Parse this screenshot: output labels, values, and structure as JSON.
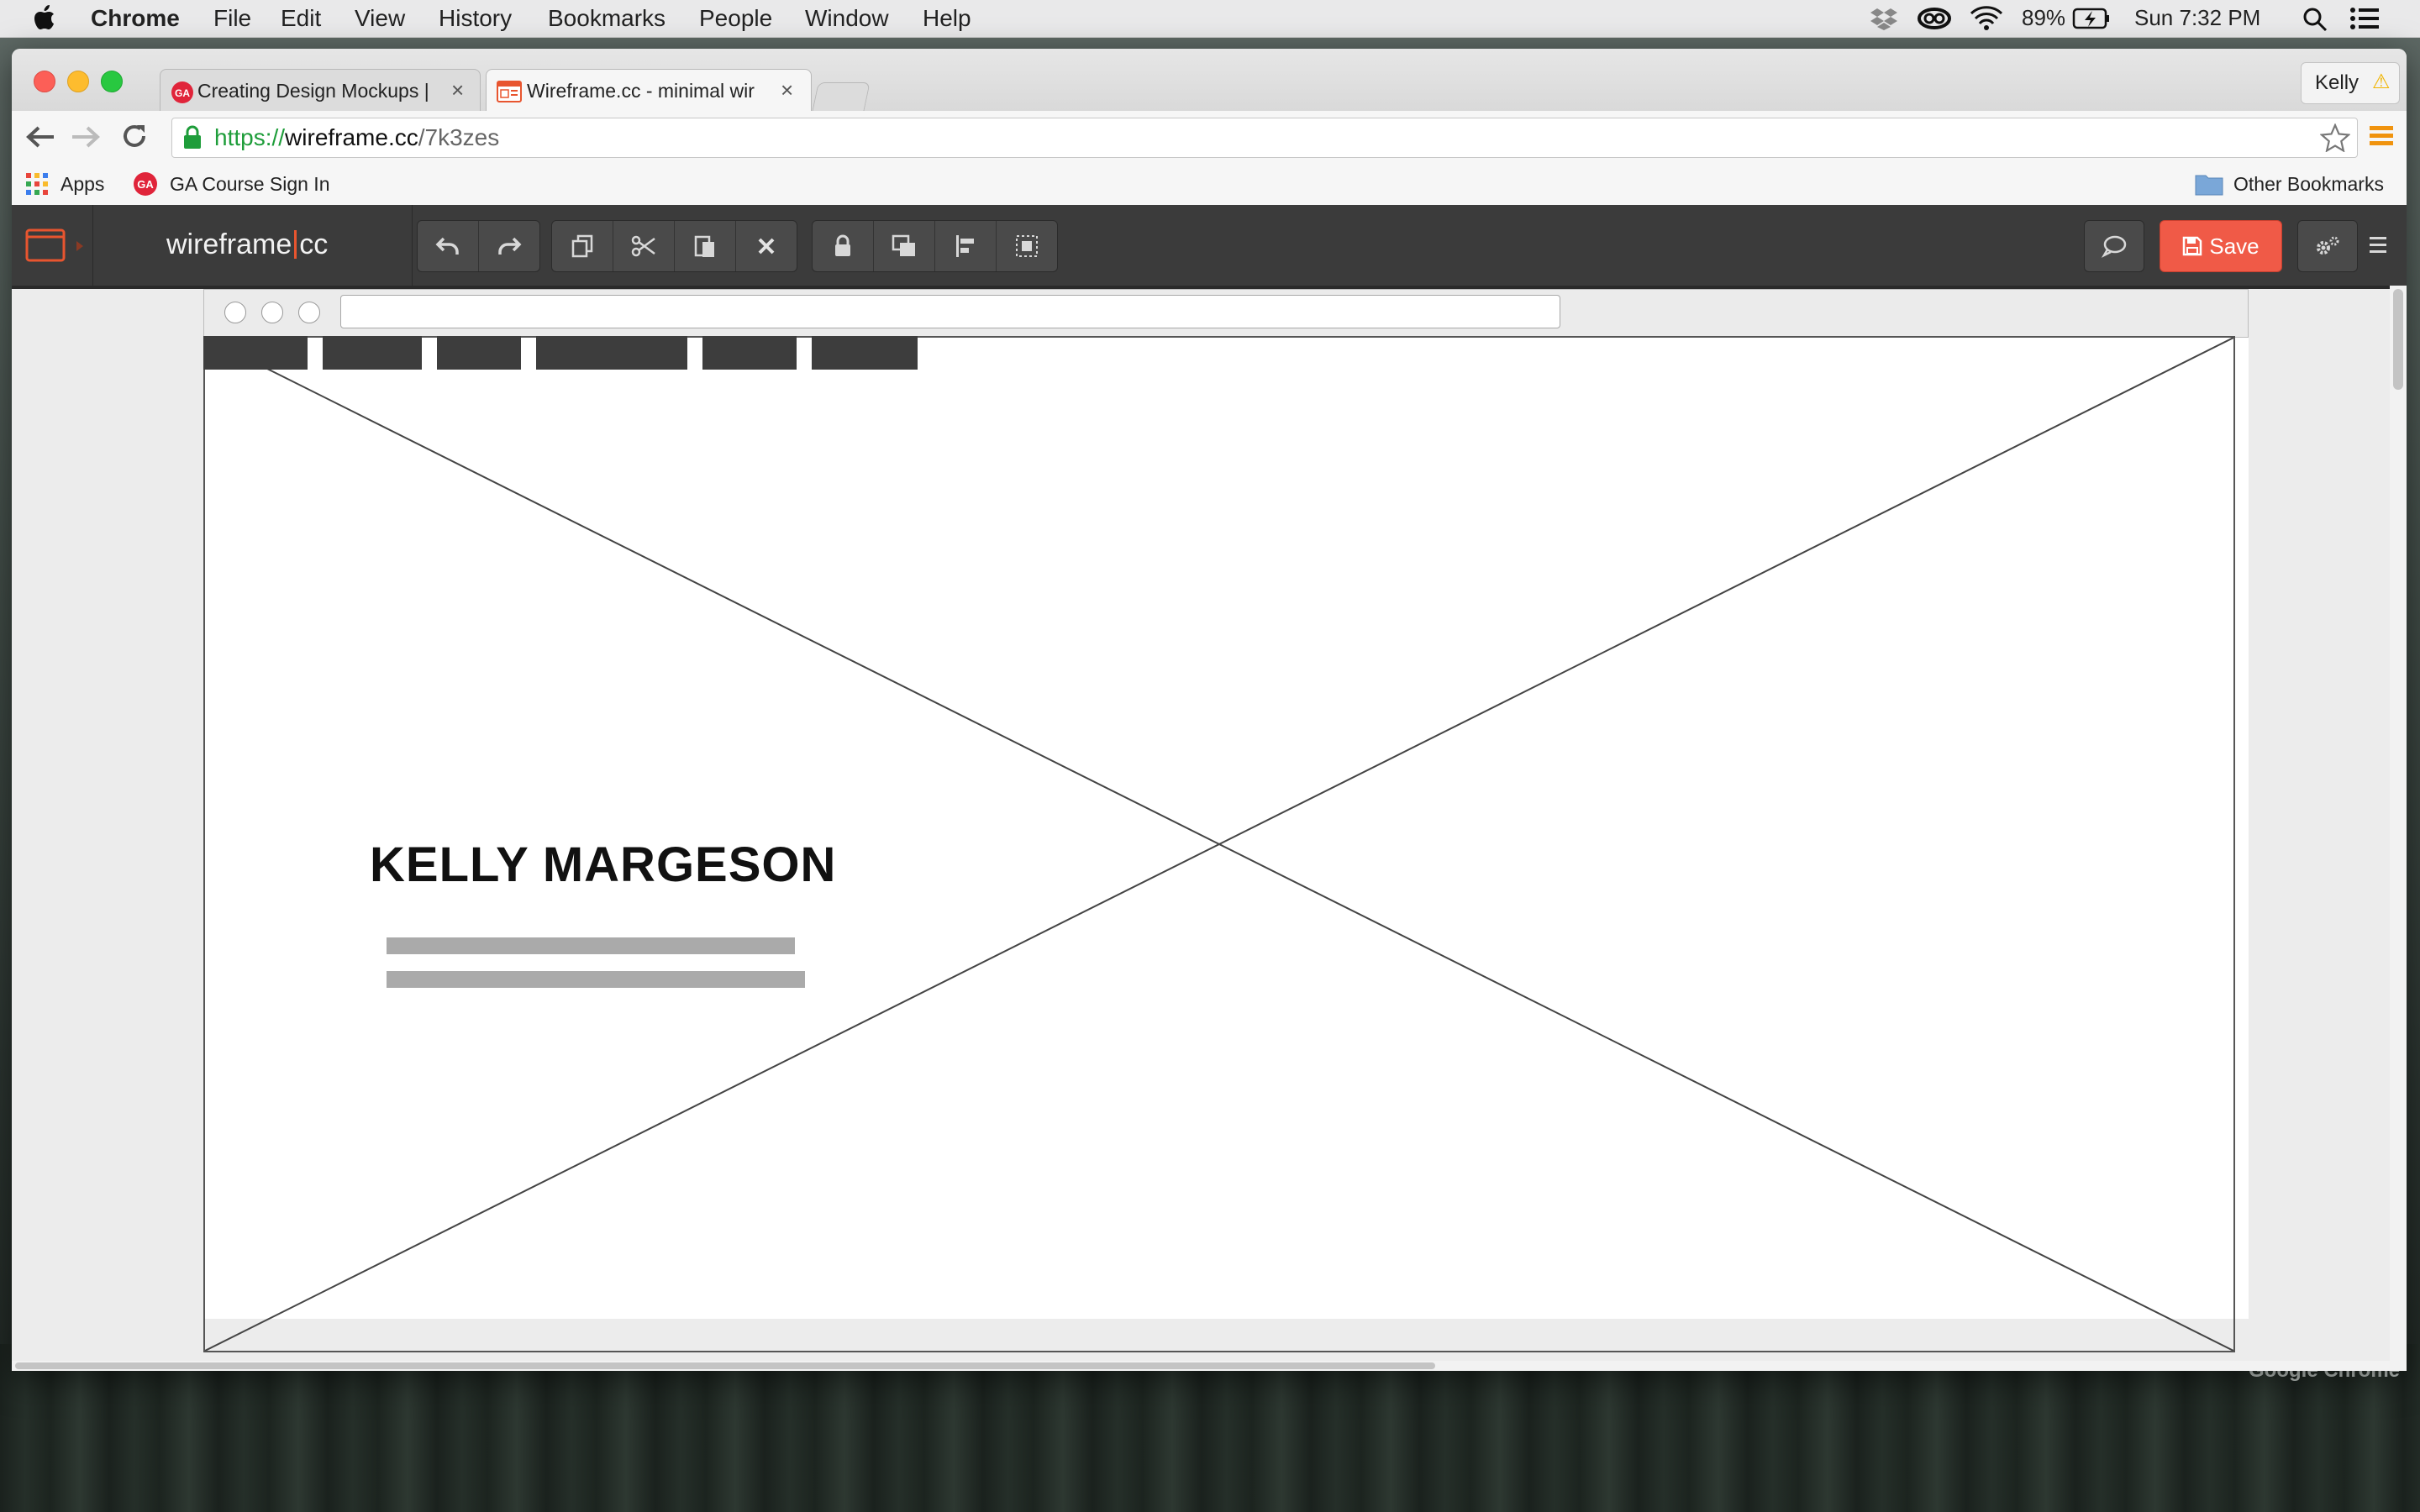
{
  "mac_menubar": {
    "apple": "",
    "app": "Chrome",
    "items": [
      "File",
      "Edit",
      "View",
      "History",
      "Bookmarks",
      "People",
      "Window",
      "Help"
    ],
    "battery": "89%",
    "clock": "Sun 7:32 PM"
  },
  "tabs": [
    {
      "title": "Creating Design Mockups |",
      "favicon": "GA",
      "close": "×"
    },
    {
      "title": "Wireframe.cc - minimal wir",
      "favicon": "wireframe",
      "close": "×"
    }
  ],
  "profile": {
    "name": "Kelly",
    "warning": "⚠"
  },
  "url": {
    "scheme": "https://",
    "host": "wireframe.cc",
    "path": "/7k3zes"
  },
  "bookmarks": {
    "apps": "Apps",
    "items": [
      {
        "label": "GA Course Sign In",
        "badge": "GA"
      }
    ],
    "other": "Other Bookmarks"
  },
  "app": {
    "logo_left": "wireframe",
    "logo_right": "cc",
    "save_label": "Save"
  },
  "wireframe": {
    "heading": "KELLY MARGESON",
    "nav_tabs": 6
  },
  "desktop": {
    "label": "Google Chrome"
  },
  "colors": {
    "save": "#f05a47",
    "appbar": "#3b3b3b",
    "nav_block": "#3d3d3d",
    "text_line": "#aaaaaa"
  }
}
